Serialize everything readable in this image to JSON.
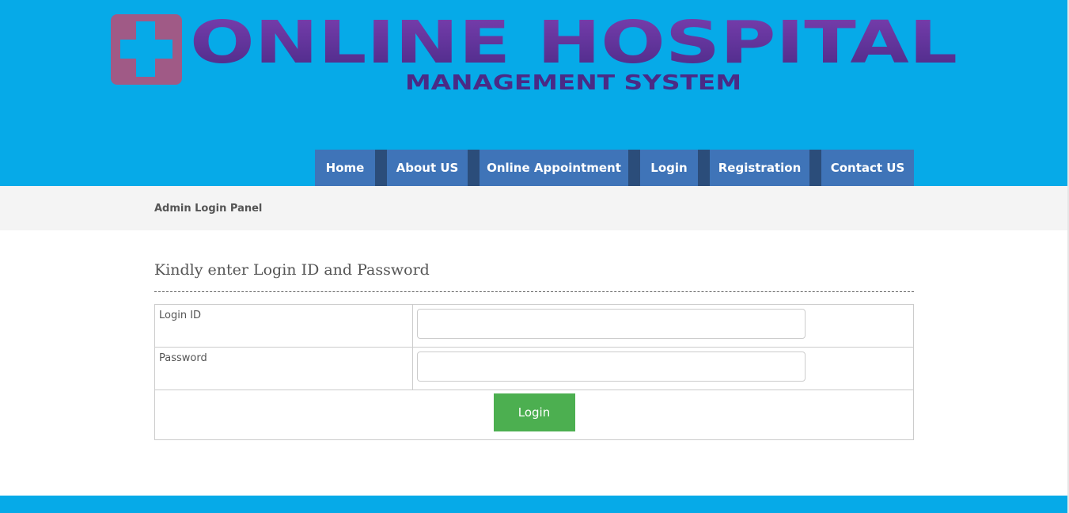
{
  "logo": {
    "title": "ONLINE HOSPITAL",
    "subtitle": "MANAGEMENT SYSTEM",
    "icon": "medical-cross-icon"
  },
  "nav": {
    "items": [
      {
        "label": "Home"
      },
      {
        "label": "About US"
      },
      {
        "label": "Online Appointment"
      },
      {
        "label": "Login"
      },
      {
        "label": "Registration"
      },
      {
        "label": "Contact US"
      }
    ]
  },
  "subbar": {
    "title": "Admin Login Panel"
  },
  "form": {
    "heading": "Kindly enter Login ID and Password",
    "login_id_label": "Login ID",
    "login_id_value": "",
    "password_label": "Password",
    "password_value": "",
    "submit_label": "Login"
  },
  "colors": {
    "header_bg": "#06aae8",
    "nav_bg": "#3f74b8",
    "nav_separator": "#2b4d7a",
    "logo_text": "#6a3593",
    "button": "#4caf50"
  }
}
